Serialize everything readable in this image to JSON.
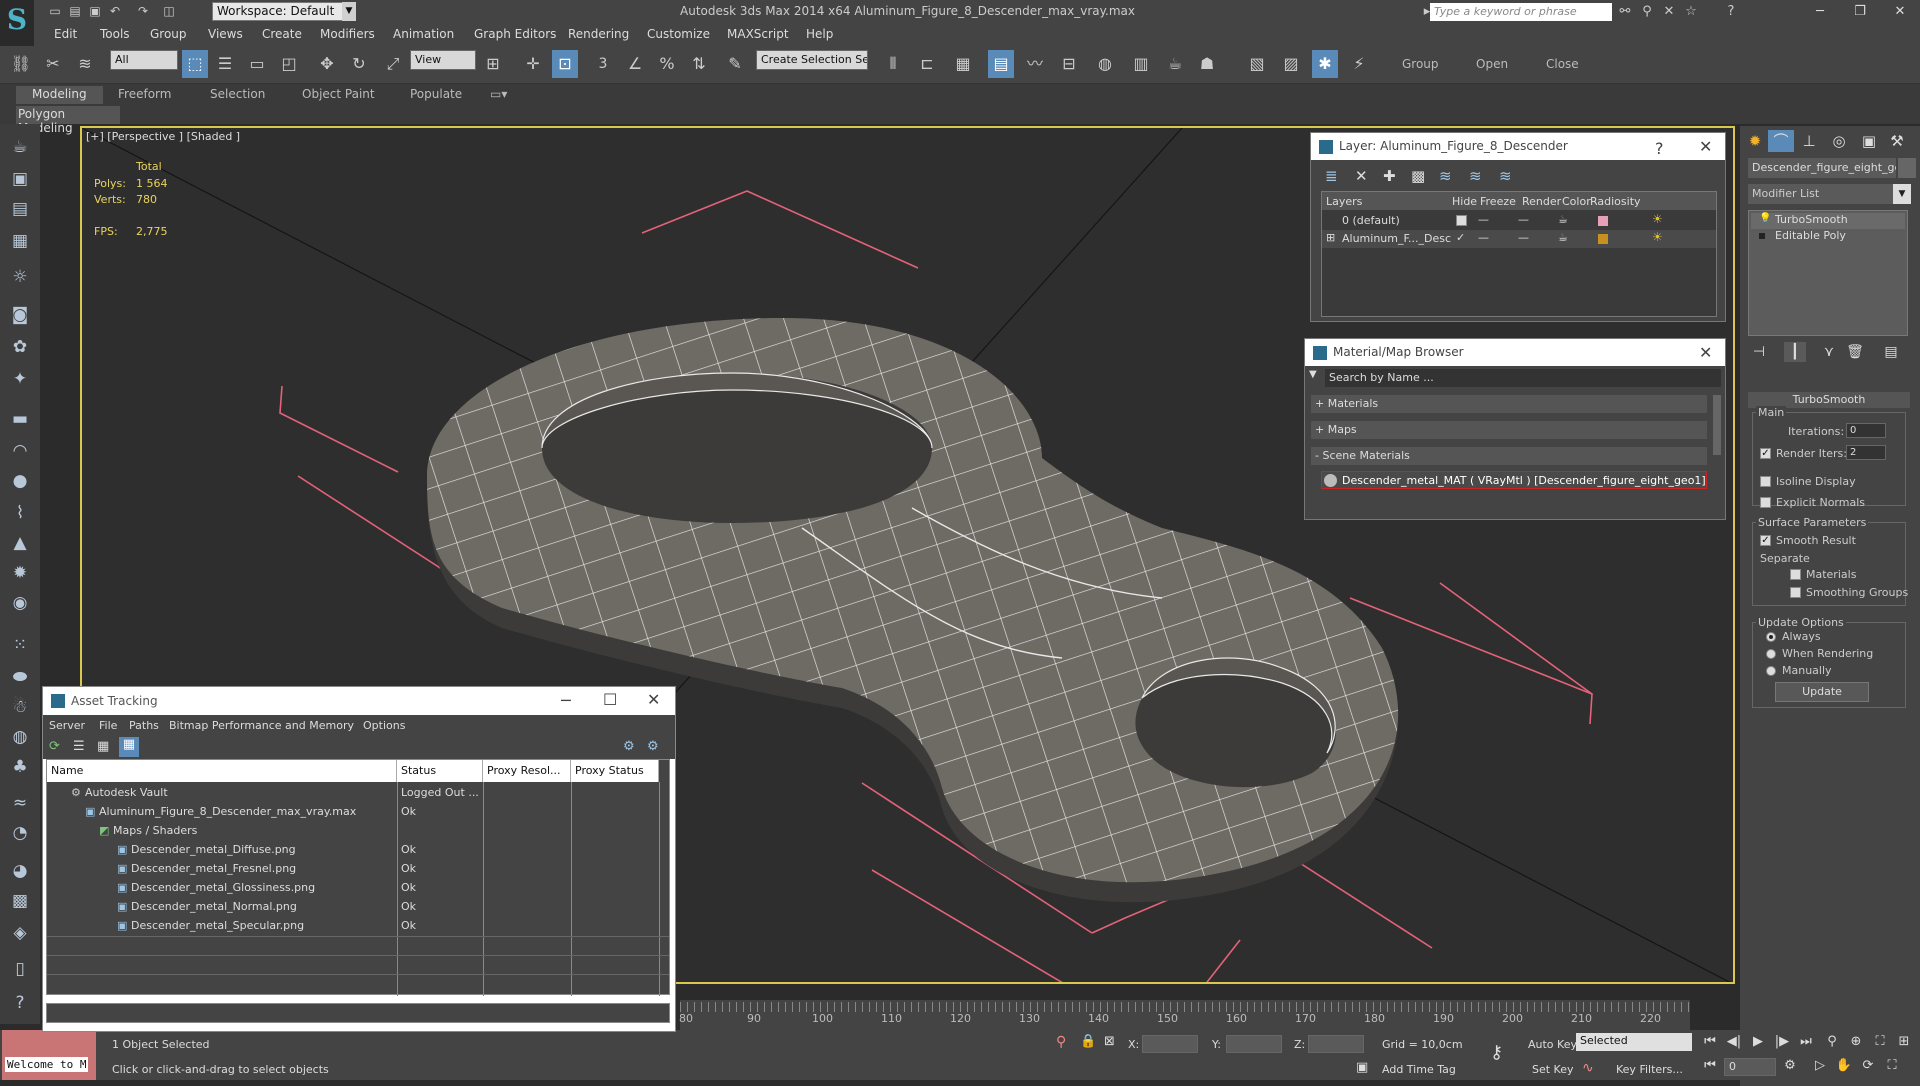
{
  "title_bar": {
    "app_title": "Autodesk 3ds Max  2014 x64     Aluminum_Figure_8_Descender_max_vray.max",
    "workspace": "Workspace: Default",
    "search_placeholder": "Type a keyword or phrase"
  },
  "menu": [
    "Edit",
    "Tools",
    "Group",
    "Views",
    "Create",
    "Modifiers",
    "Animation",
    "Graph Editors",
    "Rendering",
    "Customize",
    "MAXScript",
    "Help"
  ],
  "toolbar": {
    "selection_filter": "All",
    "ref_coord": "View",
    "named_selection": "Create Selection Se",
    "snap_3": "3",
    "group": "Group",
    "open": "Open",
    "close": "Close"
  },
  "ribbon_tabs": [
    "Modeling",
    "Freeform",
    "Selection",
    "Object Paint",
    "Populate"
  ],
  "ribbon_sub": "Polygon Modeling",
  "viewport": {
    "label": "[+] [Perspective ] [Shaded ]",
    "stats_total": "Total",
    "polys_label": "Polys:",
    "polys": "1 564",
    "verts_label": "Verts:",
    "verts": "780",
    "fps_label": "FPS:",
    "fps": "2,775"
  },
  "layer_panel": {
    "title": "Layer: Aluminum_Figure_8_Descender",
    "columns": [
      "Layers",
      "Hide",
      "Freeze",
      "Render",
      "Color",
      "Radiosity"
    ],
    "rows": [
      {
        "name": "0 (default)",
        "color": "#e8a0b8"
      },
      {
        "name": "Aluminum_F..._Desc",
        "color": "#c89020"
      }
    ]
  },
  "material_browser": {
    "title": "Material/Map Browser",
    "search_placeholder": "Search by Name ...",
    "sections": [
      "+ Materials",
      "+ Maps",
      "- Scene Materials"
    ],
    "scene_material": "Descender_metal_MAT  ( VRayMtl )  [Descender_figure_eight_geo1]"
  },
  "command_panel": {
    "object_name": "Descender_figure_eight_geo",
    "modifier_list": "Modifier List",
    "stack": [
      "TurboSmooth",
      "Editable Poly"
    ],
    "rollout_title": "TurboSmooth",
    "main_label": "Main",
    "iterations_label": "Iterations:",
    "iterations": "0",
    "render_iters_label": "Render Iters:",
    "render_iters": "2",
    "isoline": "Isoline Display",
    "explicit_normals": "Explicit Normals",
    "surface_params": "Surface Parameters",
    "smooth_result": "Smooth Result",
    "separate": "Separate",
    "materials": "Materials",
    "smoothing_groups": "Smoothing Groups",
    "update_options": "Update Options",
    "always": "Always",
    "when_rendering": "When Rendering",
    "manually": "Manually",
    "update_btn": "Update"
  },
  "asset_tracking": {
    "title": "Asset Tracking",
    "menu": [
      "Server",
      "File",
      "Paths",
      "Bitmap Performance and Memory",
      "Options"
    ],
    "columns": [
      "Name",
      "Status",
      "Proxy Resol...",
      "Proxy Status"
    ],
    "rows": [
      {
        "name": "Autodesk Vault",
        "status": "Logged Out ..."
      },
      {
        "name": "Aluminum_Figure_8_Descender_max_vray.max",
        "status": "Ok"
      },
      {
        "name": "Maps / Shaders",
        "status": ""
      },
      {
        "name": "Descender_metal_Diffuse.png",
        "status": "Ok"
      },
      {
        "name": "Descender_metal_Fresnel.png",
        "status": "Ok"
      },
      {
        "name": "Descender_metal_Glossiness.png",
        "status": "Ok"
      },
      {
        "name": "Descender_metal_Normal.png",
        "status": "Ok"
      },
      {
        "name": "Descender_metal_Specular.png",
        "status": "Ok"
      }
    ]
  },
  "timeline_ticks": [
    "80",
    "90",
    "100",
    "110",
    "120",
    "130",
    "140",
    "150",
    "160",
    "170",
    "180",
    "190",
    "200",
    "210",
    "220"
  ],
  "status": {
    "welcome": "Welcome to M",
    "selected": "1 Object Selected",
    "prompt": "Click or click-and-drag to select objects",
    "x_label": "X:",
    "y_label": "Y:",
    "z_label": "Z:",
    "grid": "Grid = 10,0cm",
    "add_time_tag": "Add Time Tag",
    "auto_key": "Auto Key",
    "selected_dd": "Selected",
    "set_key": "Set Key",
    "key_filters": "Key Filters...",
    "frame": "0"
  }
}
